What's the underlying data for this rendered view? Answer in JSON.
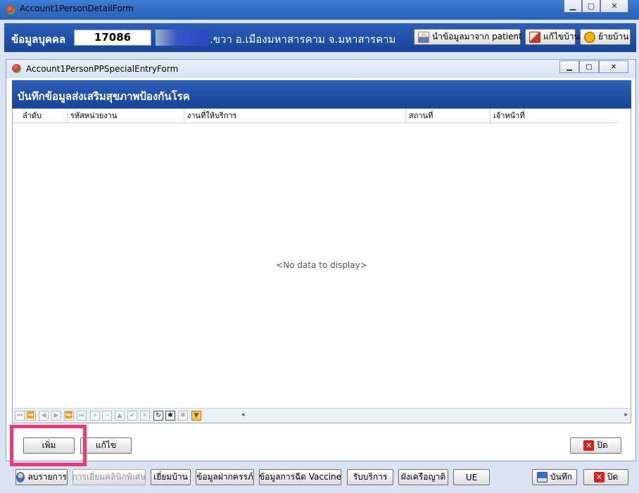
{
  "outer_window": {
    "title": "Account1PersonDetailForm",
    "minimize": "▁",
    "maximize": "▢",
    "close": "✕"
  },
  "person": {
    "label": "ข้อมูลบุคคล",
    "id": "17086",
    "address": ".ขวา อ.เมืองมหาสารคาม จ.มหาสารคาม",
    "buttons": {
      "import_patient": "นำข้อมูลมาจาก patient",
      "edit_house": "แก้ไขบ้าน",
      "move_house": "ย้ายบ้าน"
    }
  },
  "inner_window": {
    "title": "Account1PersonPPSpecialEntryForm",
    "minimize": "▁",
    "maximize": "▢",
    "close": "✕",
    "form_title": "บันทึกข้อมูลส่งเสริมสุขภาพป้องกันโรค",
    "columns": [
      "ลำดับ",
      "รหัสหน่วยงาน",
      "งานที่ให้บริการ",
      "สถานที่",
      "เจ้าหน้าที่"
    ],
    "no_data": "<No data to display>",
    "nav_buttons": [
      "⏮",
      "⏪",
      "◀",
      "▶",
      "⏩",
      "⏭",
      "+",
      "−",
      "▲",
      "✔",
      "✕",
      "↻",
      "✱",
      "✱",
      "▼"
    ],
    "scroll_left": "◂",
    "scroll_right": "▸",
    "add_button": "เพิ่ม",
    "edit_button": "แก้ไข",
    "close_button": "ปิด",
    "close_icon": "✕"
  },
  "bottom_bar": {
    "delete_item": "ลบรายการ",
    "special_clinic": "การเยี่ยมคลินิกพิเศษ",
    "home_visit": "เยี่ยมบ้าน",
    "prenatal": "ข้อมูลฝากครรภ์",
    "vaccine": "ข้อมูลการฉีด Vaccine",
    "service": "รับบริการ",
    "family_tree": "ผังเครือญาติ",
    "ue": "UE",
    "save": "บันทึก",
    "close": "ปิด",
    "close_icon": "✕"
  },
  "colors": {
    "header_blue": "#1f4fa6",
    "highlight": "#f0397a"
  }
}
